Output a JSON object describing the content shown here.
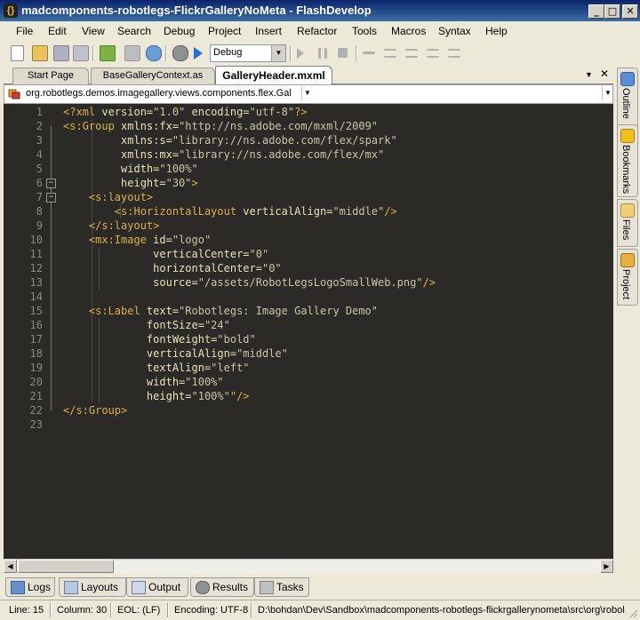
{
  "window": {
    "title": "madcomponents-robotlegs-FlickrGalleryNoMeta - FlashDevelop",
    "app_icon": "{}",
    "minimize": "_",
    "maximize": "□",
    "close": "✕"
  },
  "menu": [
    "File",
    "Edit",
    "View",
    "Search",
    "Debug",
    "Project",
    "Insert",
    "Refactor",
    "Tools",
    "Macros",
    "Syntax",
    "Help"
  ],
  "toolbar": {
    "config_value": "Debug",
    "icons": [
      "new-file-icon",
      "open-icon",
      "save-icon",
      "save-all-icon",
      "build-icon",
      "test-movie-icon",
      "settings-icon",
      "run-icon"
    ]
  },
  "tabs": [
    {
      "label": "Start Page",
      "active": false
    },
    {
      "label": "BaseGalleryContext.as",
      "active": false
    },
    {
      "label": "GalleryHeader.mxml",
      "active": true
    }
  ],
  "tab_controls": {
    "dropdown": "▼",
    "close": "✕"
  },
  "path_bar": {
    "text": "org.robotlegs.demos.imagegallery.views.components.flex.Gal",
    "arrow": "▼"
  },
  "editor": {
    "line_numbers": [
      "1",
      "2",
      "3",
      "4",
      "5",
      "6",
      "7",
      "8",
      "9",
      "10",
      "11",
      "12",
      "13",
      "14",
      "15",
      "16",
      "17",
      "18",
      "19",
      "20",
      "21",
      "22",
      "23"
    ],
    "lines": [
      [
        [
          "pi",
          "<?xml "
        ],
        [
          "at",
          "version="
        ],
        [
          "av",
          "\"1.0\""
        ],
        [
          "at",
          " encoding="
        ],
        [
          "av",
          "\"utf-8\""
        ],
        [
          "pi",
          "?>"
        ]
      ],
      [
        [
          "tg",
          "<s:Group "
        ],
        [
          "at",
          "xmlns:fx="
        ],
        [
          "av",
          "\"http://ns.adobe.com/mxml/2009\""
        ]
      ],
      [
        [
          "at",
          "         xmlns:s="
        ],
        [
          "av",
          "\"library://ns.adobe.com/flex/spark\""
        ]
      ],
      [
        [
          "at",
          "         xmlns:mx="
        ],
        [
          "av",
          "\"library://ns.adobe.com/flex/mx\""
        ]
      ],
      [
        [
          "at",
          "         width="
        ],
        [
          "av",
          "\"100%\""
        ]
      ],
      [
        [
          "at",
          "         height="
        ],
        [
          "av",
          "\"30\""
        ],
        [
          "tg",
          ">"
        ]
      ],
      [
        [
          "tg",
          "    <s:layout>"
        ]
      ],
      [
        [
          "tg",
          "        <s:HorizontalLayout "
        ],
        [
          "at",
          "verticalAlign="
        ],
        [
          "av",
          "\"middle\""
        ],
        [
          "tg",
          "/>"
        ]
      ],
      [
        [
          "tg",
          "    </s:layout>"
        ]
      ],
      [
        [
          "tg",
          "    <mx:Image "
        ],
        [
          "at",
          "id="
        ],
        [
          "av",
          "\"logo\""
        ]
      ],
      [
        [
          "at",
          "              verticalCenter="
        ],
        [
          "av",
          "\"0\""
        ]
      ],
      [
        [
          "at",
          "              horizontalCenter="
        ],
        [
          "av",
          "\"0\""
        ]
      ],
      [
        [
          "at",
          "              source="
        ],
        [
          "av",
          "\"/assets/RobotLegsLogoSmallWeb.png\""
        ],
        [
          "tg",
          "/>"
        ]
      ],
      [
        [
          "at",
          ""
        ]
      ],
      [
        [
          "tg",
          "    <s:Label "
        ],
        [
          "at",
          "text="
        ],
        [
          "av",
          "\"Robotlegs: Image Gallery Demo\""
        ]
      ],
      [
        [
          "at",
          "             fontSize="
        ],
        [
          "av",
          "\"24\""
        ]
      ],
      [
        [
          "at",
          "             fontWeight="
        ],
        [
          "av",
          "\"bold\""
        ]
      ],
      [
        [
          "at",
          "             verticalAlign="
        ],
        [
          "av",
          "\"middle\""
        ]
      ],
      [
        [
          "at",
          "             textAlign="
        ],
        [
          "av",
          "\"left\""
        ]
      ],
      [
        [
          "at",
          "             width="
        ],
        [
          "av",
          "\"100%\""
        ]
      ],
      [
        [
          "at",
          "             height="
        ],
        [
          "av",
          "\"100%\""
        ],
        [
          "tg",
          "\"/>"
        ]
      ],
      [
        [
          "tg",
          "</s:Group>"
        ]
      ],
      [
        [
          "at",
          ""
        ]
      ]
    ],
    "fold_markers": [
      "−",
      "−"
    ]
  },
  "side_tabs": [
    "Outline",
    "Bookmarks",
    "Files",
    "Project"
  ],
  "bottom_tabs": [
    "Logs",
    "Layouts",
    "Output",
    "Results",
    "Tasks"
  ],
  "status": {
    "line": "Line: 15",
    "column": "Column: 30",
    "eol": "EOL: (LF)",
    "encoding": "Encoding: UTF-8",
    "path": "D:\\bohdan\\Dev\\Sandbox\\madcomponents-robotlegs-flickrgallerynometa\\src\\org\\robol..."
  },
  "colors": {
    "editor_bg": "#2b2a26",
    "tag": "#d7b24b",
    "attribute": "#e8e2b8",
    "value": "#c9c4a8",
    "titlebar": "#0a246a"
  }
}
